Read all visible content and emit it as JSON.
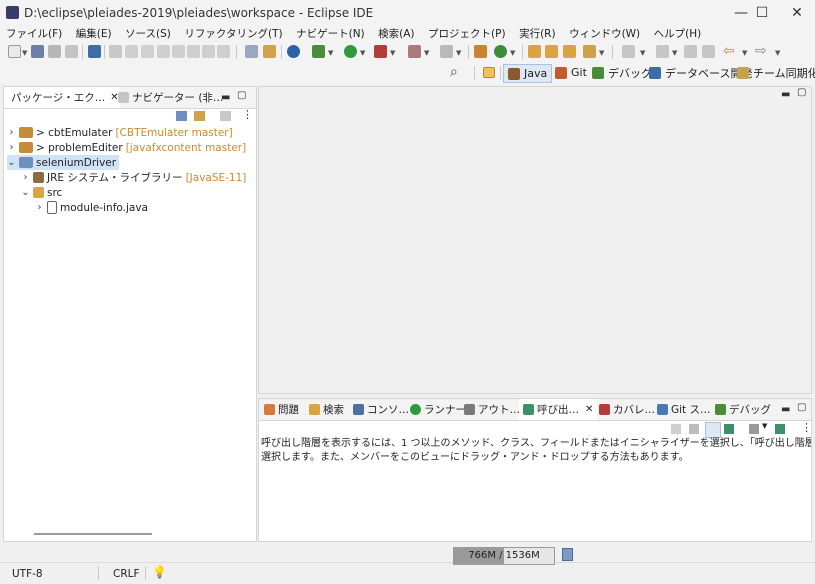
{
  "window": {
    "title": "D:\\eclipse\\pleiades-2019\\pleiades\\workspace - Eclipse IDE",
    "minimize": "—",
    "maximize": "☐",
    "close": "✕"
  },
  "menu": [
    "ファイル(F)",
    "編集(E)",
    "ソース(S)",
    "リファクタリング(T)",
    "ナビゲート(N)",
    "検索(A)",
    "プロジェクト(P)",
    "実行(R)",
    "ウィンドウ(W)",
    "ヘルプ(H)"
  ],
  "perspectives": {
    "java": "Java",
    "git": "Git",
    "debug": "デバッグ",
    "database": "データベース開発",
    "team": "チーム同期化"
  },
  "left_panel": {
    "tabs": [
      "パッケージ・エク…",
      "ナビゲーター (非…"
    ],
    "tree": [
      {
        "label": "> cbtEmulater",
        "annotation": "[CBTEmulater master]"
      },
      {
        "label": "> problemEditer",
        "annotation": "[javafxcontent master]"
      },
      {
        "label": "seleniumDriver",
        "annotation": ""
      },
      {
        "label": "JRE システム・ライブラリー",
        "annotation": "[JavaSE-11]"
      },
      {
        "label": "src",
        "annotation": ""
      },
      {
        "label": "module-info.java",
        "annotation": ""
      }
    ]
  },
  "bottom_panel": {
    "tabs": [
      "問題",
      "検索",
      "コンソ…",
      "ランナー",
      "アウト…",
      "呼び出…",
      "カバレ…",
      "Git ス…",
      "デバッグ"
    ],
    "message_line1": "呼び出し階層を表示するには、1 つ以上のメソッド、クラス、フィールドまたはイニシャライザーを選択し、「呼び出し階層を開く」メニュー・オプションを",
    "message_line2": "選択します。また、メンバーをこのビューにドラッグ・アンド・ドロップする方法もあります。"
  },
  "status": {
    "encoding": "UTF-8",
    "line_ending": "CRLF",
    "heap": "766M / 1536M",
    "heap_used_fraction": 0.499
  },
  "colors": {
    "selection": "#cfe3f7",
    "annotation": "#c98a2e",
    "heap_fill": "#9a9a9a"
  }
}
